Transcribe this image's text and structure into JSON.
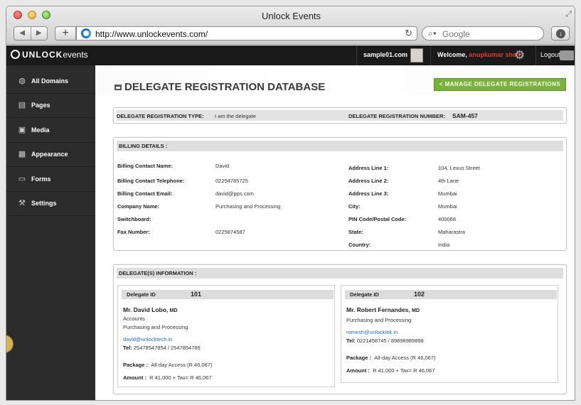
{
  "browser": {
    "window_title": "Unlock Events",
    "url": "http://www.unlockevents.com/",
    "search_placeholder": "Google"
  },
  "app": {
    "logo_bold": "UNLOCK",
    "logo_light": "events",
    "site": "sample01.com",
    "welcome_prefix": "Welcome,",
    "welcome_user": "anupkumar shetty",
    "logout": "Logout"
  },
  "sidebar": {
    "items": [
      {
        "label": "All Domains",
        "icon": "globe-icon"
      },
      {
        "label": "Pages",
        "icon": "pages-icon"
      },
      {
        "label": "Media",
        "icon": "media-icon"
      },
      {
        "label": "Appearance",
        "icon": "appearance-icon"
      },
      {
        "label": "Forms",
        "icon": "forms-icon"
      },
      {
        "label": "Settings",
        "icon": "settings-icon"
      }
    ]
  },
  "page": {
    "title": "DELEGATE REGISTRATION DATABASE",
    "manage_button": "< MANAGE DELEGATE REGISTRATIONS"
  },
  "registration": {
    "type_label": "DELEGATE REGISTRATION TYPE:",
    "type_value": "I am the delegate",
    "number_label": "DELEGATE REGISTRATION NUMBER:",
    "number_value": "SAM-457"
  },
  "billing": {
    "heading": "BILLING DETAILS :",
    "left": [
      {
        "label": "Billing Contact Name:",
        "value": "David"
      },
      {
        "label": "Billing Contact Telephone:",
        "value": "02254785725"
      },
      {
        "label": "Billing Contact Email:",
        "value": "david@pps.com"
      },
      {
        "label": "Company Name:",
        "value": "Purchasing and Processing"
      },
      {
        "label": "Switchboard:",
        "value": ""
      },
      {
        "label": "Fax Number:",
        "value": "0225874587"
      }
    ],
    "right": [
      {
        "label": "Address Line 1:",
        "value": "104, Lexus Street"
      },
      {
        "label": "Address Line 2:",
        "value": "4th Lane"
      },
      {
        "label": "Address Line 3:",
        "value": "Mumbai"
      },
      {
        "label": "City:",
        "value": "Mumbai"
      },
      {
        "label": "PIN Code/Postal Code:",
        "value": "400068"
      },
      {
        "label": "State:",
        "value": "Maharastra"
      },
      {
        "label": "Country:",
        "value": "India"
      }
    ]
  },
  "delegates": {
    "heading": "DELEGATE(S) INFORMATION :",
    "id_label": "Delegate ID",
    "package_label": "Package :",
    "amount_label": "Amount :",
    "tel_label": "Tel:",
    "list": [
      {
        "id": "101",
        "name": "Mr. David  Lobo,",
        "suffix": "MD",
        "department": "Accounts",
        "company": "Purchasing and Processing",
        "email": "david@unlocktech.in",
        "tel": "25478547854  /  2547854785",
        "package": "All-day Access (R 46,067)",
        "amount": "R  41,000 + Tax=  R  46,067"
      },
      {
        "id": "102",
        "name": "Mr. Robert  Fernandes,",
        "suffix": "MD",
        "department": "",
        "company": "Purchasing and Processing",
        "email": "romesh@unlocktek.in",
        "tel": "0221458745  /  89898989898",
        "package": "All-day Access (R 46,067)",
        "amount": "R  41,000 + Tax=  R  46,067"
      }
    ]
  }
}
